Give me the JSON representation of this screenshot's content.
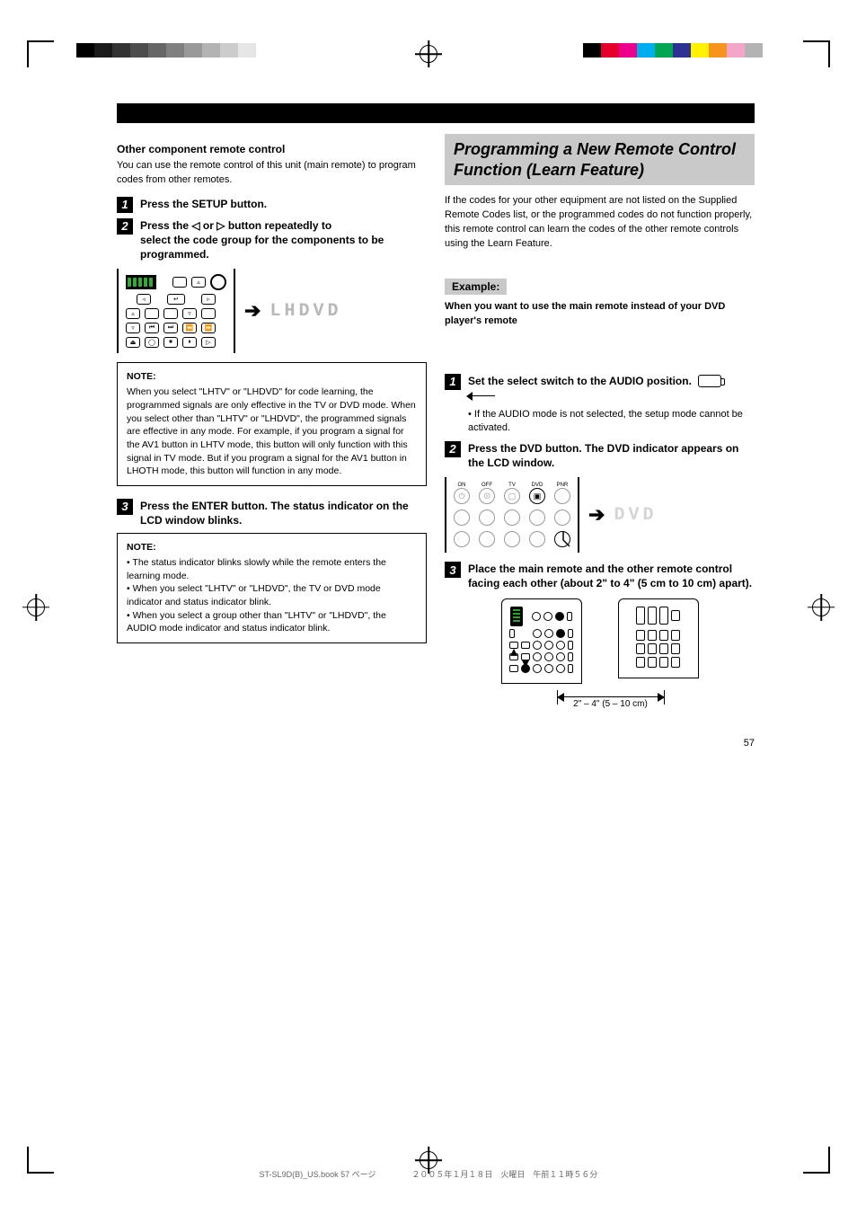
{
  "page_number": "57",
  "footer": {
    "file": "ST-SL9D(B)_US.book  57 ページ",
    "timestamp": "２００５年１月１８日　火曜日　午前１１時５６分"
  },
  "section_title": "Programming a New Remote Control Function (Learn Feature)",
  "intro_para": "If the codes for your other equipment are not listed on the Supplied Remote Codes list, or the programmed codes do not function properly, this remote control can learn the codes of the other remote controls using the Learn Feature.",
  "left": {
    "sub1": "Other component remote control",
    "para1": "You can use the remote control of this unit (main remote) to program codes from other remotes.",
    "step1": "Press the SETUP button.",
    "step2_a": "Press the ◁ or ▷ button repeatedly to",
    "step2_b": "select the code group for the components to be programmed.",
    "code_label": "LHDVD",
    "note1_head": "NOTE:",
    "note1_body": "When you select \"LHTV\" or \"LHDVD\" for code learning, the programmed signals are only effective in the TV or DVD mode. When you select other than \"LHTV\" or \"LHDVD\", the programmed signals are effective in any mode. For example, if you program a signal for the AV1 button in LHTV mode, this button will only function with this signal in TV mode. But if you program a signal for the AV1 button in LHOTH mode, this button will function in any mode.",
    "step3": "Press the ENTER button. The status indicator on the LCD window blinks.",
    "note2_head": "NOTE:",
    "note2_body1": "• The status indicator blinks slowly while the remote enters the learning mode.",
    "note2_body2": "• When you select \"LHTV\" or \"LHDVD\", the TV or DVD mode indicator and status indicator blink.",
    "note2_body3": "• When you select a group other than \"LHTV\" or \"LHDVD\", the AUDIO mode indicator and status indicator blink."
  },
  "right": {
    "gray_sub": "Example:",
    "example_text": "When you want to use the main remote instead of your DVD player's remote",
    "step1_a": "Set the select switch to the AUDIO position.",
    "step1_note": "• If the AUDIO mode is not selected, the setup mode cannot be activated.",
    "step2": "Press the DVD button. The DVD indicator appears on the LCD window.",
    "ghost_label": " DVD ",
    "step3_a": "Place the main remote and the other remote control facing each other (about 2\" to 4\" (5 cm to 10 cm) apart).",
    "distance": "2\" – 4\" (5 – 10 cm)"
  },
  "colors_left": [
    "#000",
    "#1a1a1a",
    "#333",
    "#4d4d4d",
    "#666",
    "#808080",
    "#999",
    "#b3b3b3",
    "#ccc",
    "#e6e6e6",
    "#fff"
  ],
  "colors_right": [
    "#000",
    "#e4002b",
    "#ec008c",
    "#00aeef",
    "#00a651",
    "#2e3192",
    "#fff200",
    "#f7941d",
    "#f4a6c9",
    "#b3b3b3",
    "#fff"
  ]
}
